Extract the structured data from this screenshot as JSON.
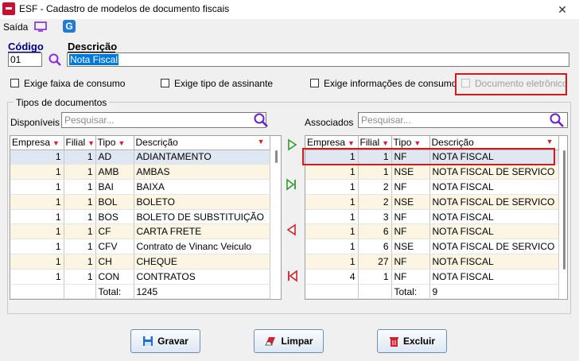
{
  "window": {
    "title": "ESF - Cadastro de modelos de documento fiscais",
    "close_glyph": "✕"
  },
  "menu": {
    "saida": "Saída",
    "g_icon_letter": "G"
  },
  "header": {
    "codigo_label": "Código",
    "codigo_value": "01",
    "descricao_label": "Descrição",
    "descricao_value": "Nota Fiscal"
  },
  "checkboxes": {
    "faixa": "Exige faixa de consumo",
    "tipo": "Exige tipo de assinante",
    "info": "Exige informações de consumo",
    "eletronico": "Documento eletrônico"
  },
  "group": {
    "title": "Tipos de documentos"
  },
  "disponiveis": {
    "label": "Disponíveis",
    "search_placeholder": "Pesquisar...",
    "columns": [
      "Empresa",
      "Filial",
      "Tipo",
      "Descrição"
    ],
    "rows": [
      [
        "1",
        "1",
        "AD",
        "ADIANTAMENTO"
      ],
      [
        "1",
        "1",
        "AMB",
        "AMBAS"
      ],
      [
        "1",
        "1",
        "BAI",
        "BAIXA"
      ],
      [
        "1",
        "1",
        "BOL",
        "BOLETO"
      ],
      [
        "1",
        "1",
        "BOS",
        "BOLETO DE SUBSTITUIÇÃO"
      ],
      [
        "1",
        "1",
        "CF",
        "CARTA FRETE"
      ],
      [
        "1",
        "1",
        "CFV",
        "Contrato de Vinanc Veiculo"
      ],
      [
        "1",
        "1",
        "CH",
        "CHEQUE"
      ],
      [
        "1",
        "1",
        "CON",
        "CONTRATOS"
      ]
    ],
    "total_label": "Total:",
    "total_value": "1245"
  },
  "associados": {
    "label": "Associados",
    "search_placeholder": "Pesquisar...",
    "columns": [
      "Empresa",
      "Filial",
      "Tipo",
      "Descrição"
    ],
    "rows": [
      [
        "1",
        "1",
        "NF",
        "NOTA FISCAL"
      ],
      [
        "1",
        "1",
        "NSE",
        "NOTA FISCAL DE SERVICO"
      ],
      [
        "1",
        "2",
        "NF",
        "NOTA FISCAL"
      ],
      [
        "1",
        "2",
        "NSE",
        "NOTA FISCAL DE SERVICO"
      ],
      [
        "1",
        "3",
        "NF",
        "NOTA FISCAL"
      ],
      [
        "1",
        "6",
        "NF",
        "NOTA FISCAL"
      ],
      [
        "1",
        "6",
        "NSE",
        "NOTA FISCAL DE SERVICO"
      ],
      [
        "1",
        "27",
        "NF",
        "NOTA FISCAL"
      ],
      [
        "4",
        "1",
        "NF",
        "NOTA FISCAL"
      ]
    ],
    "total_label": "Total:",
    "total_value": "9"
  },
  "buttons": {
    "gravar": "Gravar",
    "limpar": "Limpar",
    "excluir": "Excluir"
  },
  "colors": {
    "highlight": "#d51a1a",
    "row_alt": "#fdf5e4",
    "row_selected": "#dfe7f2",
    "filter_icon": "#d0202a"
  }
}
